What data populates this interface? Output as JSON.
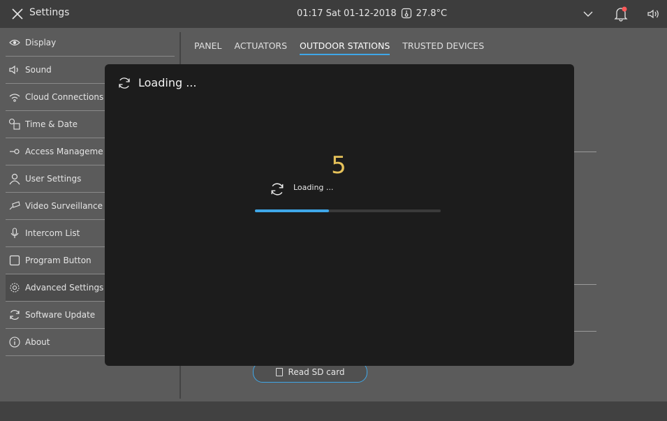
{
  "topbar": {
    "title": "Settings",
    "status": "01:17  Sat 01-12-2018",
    "temperature": "27.8°C"
  },
  "sidebar": {
    "items": [
      {
        "label": "Display",
        "icon": "eye-icon"
      },
      {
        "label": "Sound",
        "icon": "speaker-icon"
      },
      {
        "label": "Cloud Connections",
        "icon": "wifi-icon"
      },
      {
        "label": "Time & Date",
        "icon": "clock-calendar-icon"
      },
      {
        "label": "Access Manageme",
        "icon": "key-icon"
      },
      {
        "label": "User Settings",
        "icon": "user-icon"
      },
      {
        "label": "Video Surveillance",
        "icon": "camera-icon"
      },
      {
        "label": "Intercom List",
        "icon": "microphone-icon"
      },
      {
        "label": "Program Button",
        "icon": "square-icon"
      },
      {
        "label": "Advanced Settings",
        "icon": "gear-icon"
      },
      {
        "label": "Software Update",
        "icon": "refresh-icon"
      },
      {
        "label": "About",
        "icon": "info-icon"
      }
    ]
  },
  "tabs": [
    "PANEL",
    "ACTUATORS",
    "OUTDOOR STATIONS",
    "TRUSTED DEVICES"
  ],
  "read_sd_label": "Read SD card",
  "modal": {
    "title": "Loading ...",
    "countdown": "5",
    "loading_text": "Loading ...",
    "progress": 0.4
  },
  "colors": {
    "accent": "#3fa7e8",
    "countdown": "#e6c25a",
    "notification": "#ff5a5a"
  }
}
